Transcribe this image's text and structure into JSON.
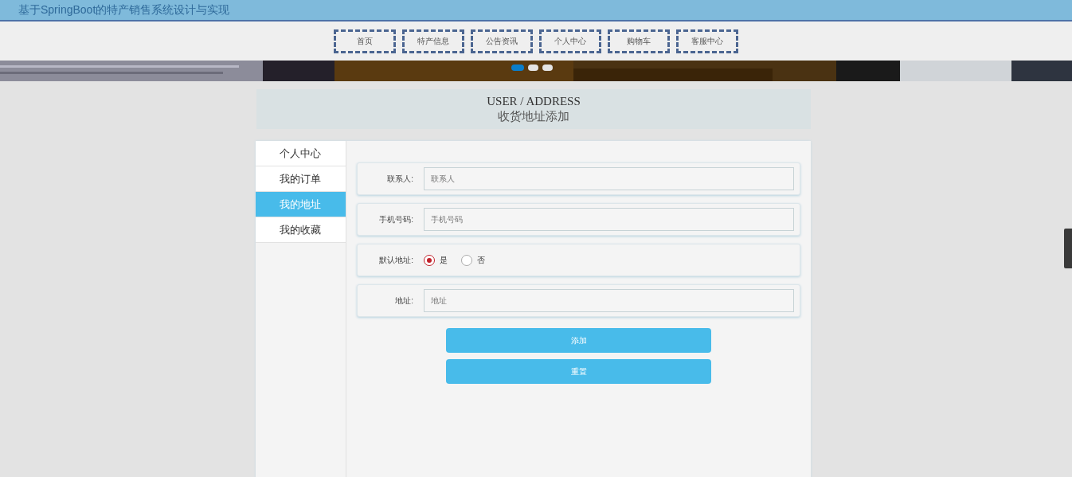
{
  "header": {
    "title": "基于SpringBoot的特产销售系统设计与实现"
  },
  "nav": [
    {
      "label": "首页"
    },
    {
      "label": "特产信息"
    },
    {
      "label": "公告资讯"
    },
    {
      "label": "个人中心"
    },
    {
      "label": "购物车"
    },
    {
      "label": "客服中心"
    }
  ],
  "banner": {
    "kind": "picture",
    "dots": [
      {
        "selected": true
      },
      {
        "selected": false
      },
      {
        "selected": false
      }
    ]
  },
  "page_title": {
    "english": "USER / ADDRESS",
    "chinese": "收货地址添加"
  },
  "sidebar": {
    "items": [
      {
        "label": "个人中心",
        "selected": false
      },
      {
        "label": "我的订单",
        "selected": false
      },
      {
        "label": "我的地址",
        "selected": true
      },
      {
        "label": "我的收藏",
        "selected": false
      }
    ]
  },
  "form": {
    "fields": [
      {
        "kind": "input",
        "label": "联系人:",
        "placeholder": "联系人"
      },
      {
        "kind": "input",
        "label": "手机号码:",
        "placeholder": "手机号码"
      },
      {
        "kind": "radio",
        "label": "默认地址:",
        "options": [
          {
            "label": "是",
            "selected": true
          },
          {
            "label": "否",
            "selected": false
          }
        ]
      },
      {
        "kind": "input",
        "label": "地址:",
        "placeholder": "地址"
      }
    ],
    "buttons": [
      {
        "label": "添加"
      },
      {
        "label": "重置"
      }
    ]
  }
}
